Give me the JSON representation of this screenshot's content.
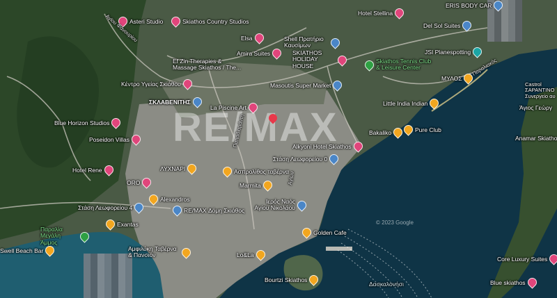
{
  "colors": {
    "sea": "#0f3446",
    "land_green": "#2f4a2a",
    "town": "#8a8d86",
    "pin_pink": "#e0457b",
    "pin_orange": "#f2a61f",
    "pin_blue": "#4a86c7",
    "pin_green": "#2ea043",
    "pin_teal": "#1ba5a5"
  },
  "watermark": "RE/MAX",
  "copyright": "© 2023 Google",
  "pois": [
    {
      "id": "asteri",
      "label": "Asteri Studio",
      "icon": "hotel-icon",
      "color": "pin_pink"
    },
    {
      "id": "country",
      "label": "Skiathos Country Studios",
      "icon": "hotel-icon",
      "color": "pin_pink"
    },
    {
      "id": "stellina",
      "label": "Hotel Stellina",
      "icon": "hotel-icon",
      "color": "pin_pink"
    },
    {
      "id": "bodycare",
      "label": "ERIS BODY CAR",
      "icon": "shop-icon",
      "color": "pin_blue"
    },
    {
      "id": "delsol",
      "label": "Del Sol Suites",
      "icon": "hotel-icon",
      "color": "pin_blue"
    },
    {
      "id": "elsa",
      "label": "Elsa",
      "icon": "hotel-icon",
      "color": "pin_pink"
    },
    {
      "id": "shell",
      "label": "Shell Πρατήριο Καυσίμων",
      "icon": "gas-icon",
      "color": "pin_blue"
    },
    {
      "id": "amira",
      "label": "Amira Suites",
      "icon": "hotel-icon",
      "color": "pin_pink"
    },
    {
      "id": "holiday",
      "label": "SKIATHOS HOLIDAY HOUSE",
      "icon": "hotel-icon",
      "color": "pin_pink"
    },
    {
      "id": "tennis",
      "label": "Skiathos Tennis Club & Leisure Center",
      "icon": "park-icon",
      "color": "pin_green"
    },
    {
      "id": "jsi",
      "label": "JSI Planespotting",
      "icon": "camera-icon",
      "color": "pin_teal"
    },
    {
      "id": "efzin",
      "label": "Ef Zin Therapies & Massage Skiathos / The...",
      "icon": "spa-icon",
      "color": "pin_blue"
    },
    {
      "id": "kentro",
      "label": "Κέντρο Υγείας Σκιάθου",
      "icon": "hospital-icon",
      "color": "pin_pink"
    },
    {
      "id": "masoutis",
      "label": "Masoutis Super Market",
      "icon": "cart-icon",
      "color": "pin_blue"
    },
    {
      "id": "mylos",
      "label": "ΜΥΛΟΣ",
      "icon": "restaurant-icon",
      "color": "pin_orange"
    },
    {
      "id": "sklavenitis",
      "label": "ΣΚΛΑΒΕΝΙΤΗΣ",
      "icon": "cart-icon",
      "color": "pin_blue"
    },
    {
      "id": "piscine",
      "label": "La Piscine Art",
      "icon": "hotel-icon",
      "color": "pin_pink"
    },
    {
      "id": "littleindia",
      "label": "Little India Indian",
      "icon": "restaurant-icon",
      "color": "pin_orange"
    },
    {
      "id": "bluehorizon",
      "label": "Blue Horizon Studios",
      "icon": "hotel-icon",
      "color": "pin_pink"
    },
    {
      "id": "bakaliko",
      "label": "Bakaliko",
      "icon": "restaurant-icon",
      "color": "pin_orange"
    },
    {
      "id": "pureclub",
      "label": "Pure Club",
      "icon": "bar-icon",
      "color": "pin_orange"
    },
    {
      "id": "alkyoni",
      "label": "Alkyoni Hotel Skiathos",
      "icon": "hotel-icon",
      "color": "pin_pink"
    },
    {
      "id": "poseidon",
      "label": "Poseidon Villas",
      "icon": "hotel-icon",
      "color": "pin_pink"
    },
    {
      "id": "stasi0",
      "label": "Στάση Λεωφορείου 0",
      "icon": "bus-icon",
      "color": "pin_blue"
    },
    {
      "id": "hotelrene",
      "label": "Hotel Rene",
      "icon": "hotel-icon",
      "color": "pin_pink"
    },
    {
      "id": "lychnari",
      "label": "ΛΥΧΝΑΡΙ",
      "icon": "restaurant-icon",
      "color": "pin_orange"
    },
    {
      "id": "aprolithos",
      "label": "Ασπρολίθος ταβέρνα",
      "icon": "restaurant-icon",
      "color": "pin_orange"
    },
    {
      "id": "oro",
      "label": "ORO",
      "icon": "hotel-icon",
      "color": "pin_pink"
    },
    {
      "id": "marmita",
      "label": "Marmita",
      "icon": "restaurant-icon",
      "color": "pin_orange"
    },
    {
      "id": "alexandros",
      "label": "Alexandros",
      "icon": "restaurant-icon",
      "color": "pin_orange"
    },
    {
      "id": "remax",
      "label": "RE/MAX Δόμη Σκιάθος",
      "icon": "building-icon",
      "color": "pin_blue"
    },
    {
      "id": "ieros",
      "label": "Ιερός Ναός Αγίου Νικολάου",
      "icon": "church-icon",
      "color": "pin_blue"
    },
    {
      "id": "stasi4",
      "label": "Στάση Λεωφορείου 4",
      "icon": "bus-icon",
      "color": "pin_blue"
    },
    {
      "id": "exantas",
      "label": "Exantas",
      "icon": "restaurant-icon",
      "color": "pin_orange"
    },
    {
      "id": "paralia",
      "label": "Παραλία Μεγάλη Άμμος",
      "icon": "beach-icon",
      "color": "pin_green"
    },
    {
      "id": "golden",
      "label": "Golden Cafe",
      "icon": "cafe-icon",
      "color": "pin_orange"
    },
    {
      "id": "swellbeach",
      "label": "Swell Beach Bar",
      "icon": "bar-icon",
      "color": "pin_orange"
    },
    {
      "id": "amfilyki",
      "label": "Αμφιλύκη Ταβέρνα & Πανσιόν",
      "icon": "restaurant-icon",
      "color": "pin_orange"
    },
    {
      "id": "lola",
      "label": "Lo&La",
      "icon": "restaurant-icon",
      "color": "pin_orange"
    },
    {
      "id": "bourtzi",
      "label": "Bourtzi Skiathos",
      "icon": "landmark-icon",
      "color": "pin_orange"
    },
    {
      "id": "coreluxury",
      "label": "Core Luxury Suites",
      "icon": "hotel-icon",
      "color": "pin_pink"
    },
    {
      "id": "blueskiathos",
      "label": "Blue skiathos",
      "icon": "hotel-icon",
      "color": "pin_pink"
    },
    {
      "id": "castro",
      "label": "Castrol ΣΑΡΑΝΤΙΝΟ Συνεργείο αυ",
      "icon": "car-repair-icon",
      "color": "pin_blue"
    }
  ],
  "labels": {
    "agios_fanourios": "Αγίου Φανουρίου",
    "paraliaki": "Παραλιακός",
    "agios_georgios": "Άγιος Γεώργ",
    "anamar": "Anamar Skiatho",
    "daskaloni": "Δασκαλονήσι",
    "road_center": "Παπαδιαμάντη",
    "road_center2": "Αγίων"
  }
}
